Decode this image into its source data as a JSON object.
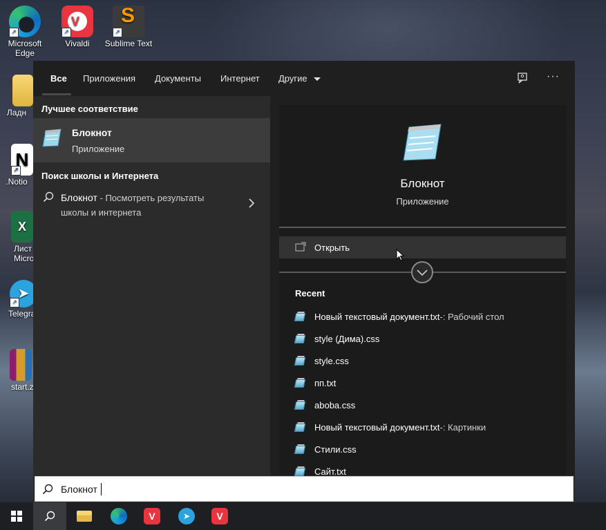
{
  "desktop": {
    "icons": [
      {
        "label": "Microsoft Edge",
        "icon": "edge-icon"
      },
      {
        "label": "Vivaldi",
        "icon": "vivaldi-icon"
      },
      {
        "label": "Sublime Text",
        "icon": "sublime-text-icon"
      },
      {
        "label": "Ладн",
        "icon": "folder-icon"
      },
      {
        "label": ".Notio",
        "icon": "notion-icon"
      },
      {
        "label": "Лист Micros",
        "icon": "excel-icon"
      },
      {
        "label": "Telegra",
        "icon": "telegram-icon"
      },
      {
        "label": "start.z",
        "icon": "winrar-archive-icon"
      }
    ]
  },
  "tabs": {
    "all": "Все",
    "apps": "Приложения",
    "docs": "Документы",
    "web": "Интернет",
    "other": "Другие"
  },
  "left": {
    "best_match_header": "Лучшее соответствие",
    "best_match": {
      "title": "Блокнот",
      "subtitle": "Приложение"
    },
    "web_header": "Поиск школы и Интернета",
    "web_result": {
      "query": "Блокнот",
      "suffix": " - Посмотреть результаты",
      "line2": "школы и интернета"
    }
  },
  "preview": {
    "title": "Блокнот",
    "subtitle": "Приложение",
    "open_label": "Открыть",
    "recent_header": "Recent",
    "recent": [
      {
        "name": "Новый текстовый документ.txt",
        "location": " -: Рабочий стол"
      },
      {
        "name": "style (Дима).css",
        "location": ""
      },
      {
        "name": "style.css",
        "location": ""
      },
      {
        "name": "пп.txt",
        "location": ""
      },
      {
        "name": "aboba.css",
        "location": ""
      },
      {
        "name": "Новый текстовый документ.txt",
        "location": " -: Картинки"
      },
      {
        "name": "Стили.css",
        "location": ""
      },
      {
        "name": "Сайт.txt",
        "location": ""
      }
    ]
  },
  "search": {
    "value": "Блокнот"
  },
  "colors": {
    "accent_underline": "#4a4a4a",
    "panel_bg": "#2b2b2b",
    "preview_bg": "#1b1b1b",
    "taskbar_bg": "#1e1f22"
  }
}
